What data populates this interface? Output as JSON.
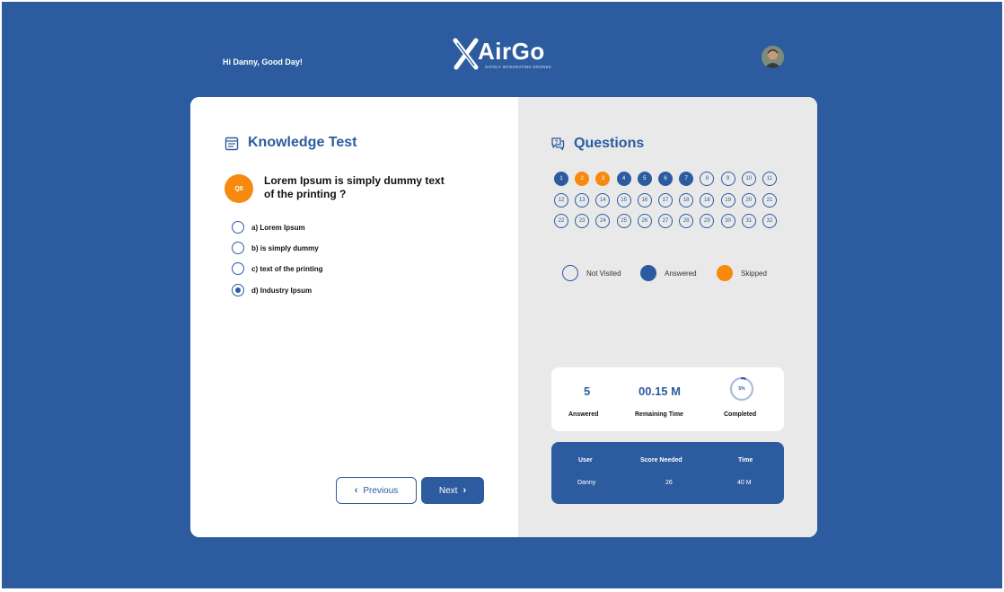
{
  "header": {
    "greeting": "Hi Danny, Good Day!",
    "logo_text": "AirGo",
    "logo_tagline": "SAFELY INTEGRATING DRONES"
  },
  "left": {
    "title": "Knowledge Test",
    "question_badge": "Q8",
    "question_text_line1": "Lorem Ipsum is simply dummy text",
    "question_text_line2": "of the printing ?",
    "options": [
      {
        "label": "a) Lorem Ipsum",
        "selected": false
      },
      {
        "label": "b) is simply dummy",
        "selected": false
      },
      {
        "label": "c) text of the printing",
        "selected": false
      },
      {
        "label": "d) Industry Ipsum",
        "selected": true
      }
    ],
    "prev_label": "Previous",
    "next_label": "Next"
  },
  "right": {
    "title": "Questions",
    "questions": [
      {
        "n": "1",
        "state": "answered"
      },
      {
        "n": "2",
        "state": "skipped"
      },
      {
        "n": "3",
        "state": "skipped"
      },
      {
        "n": "4",
        "state": "answered"
      },
      {
        "n": "5",
        "state": "answered"
      },
      {
        "n": "6",
        "state": "answered"
      },
      {
        "n": "7",
        "state": "answered"
      },
      {
        "n": "8",
        "state": "not-visited"
      },
      {
        "n": "9",
        "state": "not-visited"
      },
      {
        "n": "10",
        "state": "not-visited"
      },
      {
        "n": "11",
        "state": "not-visited"
      },
      {
        "n": "12",
        "state": "not-visited"
      },
      {
        "n": "13",
        "state": "not-visited"
      },
      {
        "n": "14",
        "state": "not-visited"
      },
      {
        "n": "15",
        "state": "not-visited"
      },
      {
        "n": "16",
        "state": "not-visited"
      },
      {
        "n": "17",
        "state": "not-visited"
      },
      {
        "n": "18",
        "state": "not-visited"
      },
      {
        "n": "18",
        "state": "not-visited"
      },
      {
        "n": "19",
        "state": "not-visited"
      },
      {
        "n": "20",
        "state": "not-visited"
      },
      {
        "n": "21",
        "state": "not-visited"
      },
      {
        "n": "22",
        "state": "not-visited"
      },
      {
        "n": "23",
        "state": "not-visited"
      },
      {
        "n": "24",
        "state": "not-visited"
      },
      {
        "n": "25",
        "state": "not-visited"
      },
      {
        "n": "26",
        "state": "not-visited"
      },
      {
        "n": "27",
        "state": "not-visited"
      },
      {
        "n": "28",
        "state": "not-visited"
      },
      {
        "n": "29",
        "state": "not-visited"
      },
      {
        "n": "30",
        "state": "not-visited"
      },
      {
        "n": "31",
        "state": "not-visited"
      },
      {
        "n": "32",
        "state": "not-visited"
      }
    ],
    "legend": {
      "not_visited": "Not Visited",
      "answered": "Answered",
      "skipped": "Skipped"
    },
    "stats": {
      "answered_value": "5",
      "answered_label": "Answered",
      "time_value": "00.15 M",
      "time_label": "Remaining Time",
      "completed_percent": "5%",
      "completed_fraction": 0.05,
      "completed_label": "Completed"
    },
    "score": {
      "headers": {
        "user": "User",
        "score": "Score Needed",
        "time": "Time"
      },
      "row": {
        "user": "Danny",
        "score": "26",
        "time": "40 M"
      }
    }
  },
  "colors": {
    "primary": "#2c5c9f",
    "accent": "#f7890f",
    "panel": "#e9e9e9"
  }
}
